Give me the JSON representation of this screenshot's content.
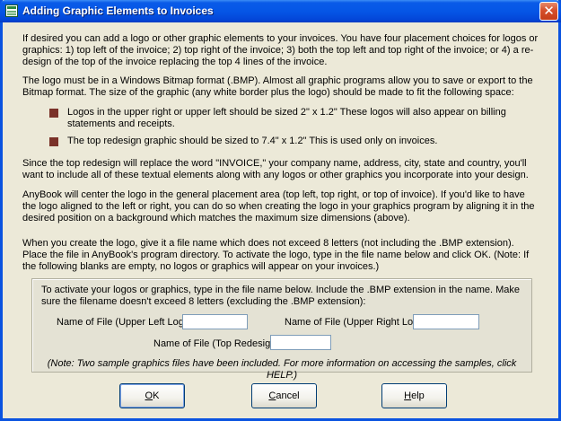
{
  "window": {
    "title": "Adding Graphic Elements to Invoices",
    "close_glyph": "✕",
    "app_icon": "table-icon"
  },
  "body": {
    "para1": "If desired you can add a logo or other graphic elements to your invoices.  You have four placement choices for logos or graphics:  1) top left of the invoice; 2) top right of the invoice; 3) both the top left and top right of the invoice;  or 4) a re-design of the top of the invoice replacing the top 4 lines of the invoice.",
    "para2": "The logo must be in a Windows Bitmap format (.BMP).  Almost all graphic programs allow you to save or export to the Bitmap format.  The size of the graphic (any white border plus the logo) should be made to fit the following space:",
    "bullets": [
      "Logos in the upper right or upper left should be sized 2\" x 1.2\"  These logos will also appear on billing statements and receipts.",
      "The top redesign graphic should be sized to 7.4\" x 1.2\"  This is used only on invoices."
    ],
    "para3": "Since the top redesign will replace the word \"INVOICE,\" your company name, address, city, state and country, you'll want to include all of these textual elements along with any logos or other graphics you incorporate into your design.",
    "para4": "AnyBook will center the logo in the general placement area (top left, top right, or top of invoice).  If you'd like to have the logo aligned to the left or right, you can do so when creating the logo in your graphics program by aligning it in the desired position on a background which matches the maximum size dimensions (above).",
    "para5": "When you create the logo, give it a file name which does not exceed 8 letters (not including the .BMP extension).   Place the file in AnyBook's program directory.  To activate the logo, type in the file name below and click OK. (Note: If the following blanks are empty, no logos or graphics will appear on your invoices.)"
  },
  "form": {
    "instructions": "To activate your logos or graphics, type in the file name below.  Include the .BMP extension in the name.  Make sure the filename doesn't exceed 8 letters (excluding the .BMP extension):",
    "upper_left_label": "Name of File (Upper Left Logo):",
    "upper_left_value": "",
    "upper_right_label": "Name of File (Upper Right Logo):",
    "upper_right_value": "",
    "top_redesign_label": "Name of File (Top Redesign):",
    "top_redesign_value": "",
    "note": "(Note: Two sample graphics files have been included.  For more information on accessing the samples, click HELP.)"
  },
  "buttons": {
    "ok_mnemonic": "O",
    "ok_rest": "K",
    "cancel_mnemonic": "C",
    "cancel_rest": "ancel",
    "help_mnemonic": "H",
    "help_rest": "elp"
  },
  "colors": {
    "bullet": "#7a3128",
    "title_bar": "#0556e6",
    "dialog_bg": "#ece9d8"
  }
}
